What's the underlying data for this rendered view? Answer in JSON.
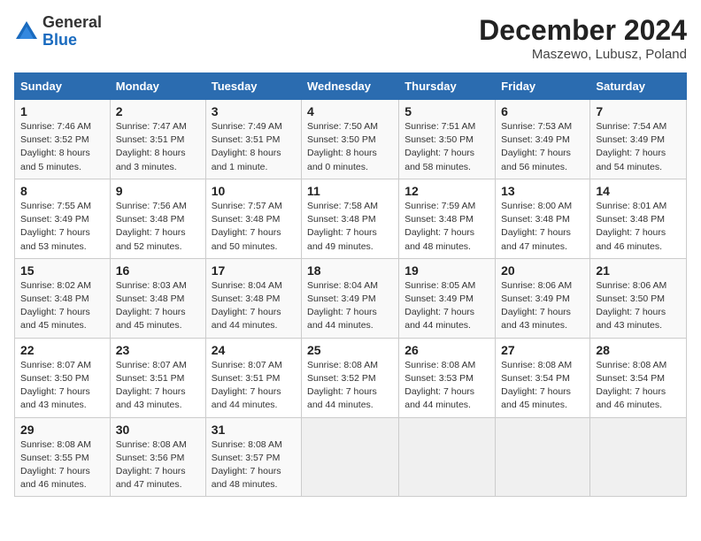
{
  "logo": {
    "general": "General",
    "blue": "Blue"
  },
  "title": "December 2024",
  "location": "Maszewo, Lubusz, Poland",
  "days_of_week": [
    "Sunday",
    "Monday",
    "Tuesday",
    "Wednesday",
    "Thursday",
    "Friday",
    "Saturday"
  ],
  "weeks": [
    [
      {
        "day": "1",
        "info": "Sunrise: 7:46 AM\nSunset: 3:52 PM\nDaylight: 8 hours\nand 5 minutes."
      },
      {
        "day": "2",
        "info": "Sunrise: 7:47 AM\nSunset: 3:51 PM\nDaylight: 8 hours\nand 3 minutes."
      },
      {
        "day": "3",
        "info": "Sunrise: 7:49 AM\nSunset: 3:51 PM\nDaylight: 8 hours\nand 1 minute."
      },
      {
        "day": "4",
        "info": "Sunrise: 7:50 AM\nSunset: 3:50 PM\nDaylight: 8 hours\nand 0 minutes."
      },
      {
        "day": "5",
        "info": "Sunrise: 7:51 AM\nSunset: 3:50 PM\nDaylight: 7 hours\nand 58 minutes."
      },
      {
        "day": "6",
        "info": "Sunrise: 7:53 AM\nSunset: 3:49 PM\nDaylight: 7 hours\nand 56 minutes."
      },
      {
        "day": "7",
        "info": "Sunrise: 7:54 AM\nSunset: 3:49 PM\nDaylight: 7 hours\nand 54 minutes."
      }
    ],
    [
      {
        "day": "8",
        "info": "Sunrise: 7:55 AM\nSunset: 3:49 PM\nDaylight: 7 hours\nand 53 minutes."
      },
      {
        "day": "9",
        "info": "Sunrise: 7:56 AM\nSunset: 3:48 PM\nDaylight: 7 hours\nand 52 minutes."
      },
      {
        "day": "10",
        "info": "Sunrise: 7:57 AM\nSunset: 3:48 PM\nDaylight: 7 hours\nand 50 minutes."
      },
      {
        "day": "11",
        "info": "Sunrise: 7:58 AM\nSunset: 3:48 PM\nDaylight: 7 hours\nand 49 minutes."
      },
      {
        "day": "12",
        "info": "Sunrise: 7:59 AM\nSunset: 3:48 PM\nDaylight: 7 hours\nand 48 minutes."
      },
      {
        "day": "13",
        "info": "Sunrise: 8:00 AM\nSunset: 3:48 PM\nDaylight: 7 hours\nand 47 minutes."
      },
      {
        "day": "14",
        "info": "Sunrise: 8:01 AM\nSunset: 3:48 PM\nDaylight: 7 hours\nand 46 minutes."
      }
    ],
    [
      {
        "day": "15",
        "info": "Sunrise: 8:02 AM\nSunset: 3:48 PM\nDaylight: 7 hours\nand 45 minutes."
      },
      {
        "day": "16",
        "info": "Sunrise: 8:03 AM\nSunset: 3:48 PM\nDaylight: 7 hours\nand 45 minutes."
      },
      {
        "day": "17",
        "info": "Sunrise: 8:04 AM\nSunset: 3:48 PM\nDaylight: 7 hours\nand 44 minutes."
      },
      {
        "day": "18",
        "info": "Sunrise: 8:04 AM\nSunset: 3:49 PM\nDaylight: 7 hours\nand 44 minutes."
      },
      {
        "day": "19",
        "info": "Sunrise: 8:05 AM\nSunset: 3:49 PM\nDaylight: 7 hours\nand 44 minutes."
      },
      {
        "day": "20",
        "info": "Sunrise: 8:06 AM\nSunset: 3:49 PM\nDaylight: 7 hours\nand 43 minutes."
      },
      {
        "day": "21",
        "info": "Sunrise: 8:06 AM\nSunset: 3:50 PM\nDaylight: 7 hours\nand 43 minutes."
      }
    ],
    [
      {
        "day": "22",
        "info": "Sunrise: 8:07 AM\nSunset: 3:50 PM\nDaylight: 7 hours\nand 43 minutes."
      },
      {
        "day": "23",
        "info": "Sunrise: 8:07 AM\nSunset: 3:51 PM\nDaylight: 7 hours\nand 43 minutes."
      },
      {
        "day": "24",
        "info": "Sunrise: 8:07 AM\nSunset: 3:51 PM\nDaylight: 7 hours\nand 44 minutes."
      },
      {
        "day": "25",
        "info": "Sunrise: 8:08 AM\nSunset: 3:52 PM\nDaylight: 7 hours\nand 44 minutes."
      },
      {
        "day": "26",
        "info": "Sunrise: 8:08 AM\nSunset: 3:53 PM\nDaylight: 7 hours\nand 44 minutes."
      },
      {
        "day": "27",
        "info": "Sunrise: 8:08 AM\nSunset: 3:54 PM\nDaylight: 7 hours\nand 45 minutes."
      },
      {
        "day": "28",
        "info": "Sunrise: 8:08 AM\nSunset: 3:54 PM\nDaylight: 7 hours\nand 46 minutes."
      }
    ],
    [
      {
        "day": "29",
        "info": "Sunrise: 8:08 AM\nSunset: 3:55 PM\nDaylight: 7 hours\nand 46 minutes."
      },
      {
        "day": "30",
        "info": "Sunrise: 8:08 AM\nSunset: 3:56 PM\nDaylight: 7 hours\nand 47 minutes."
      },
      {
        "day": "31",
        "info": "Sunrise: 8:08 AM\nSunset: 3:57 PM\nDaylight: 7 hours\nand 48 minutes."
      },
      {
        "day": "",
        "info": ""
      },
      {
        "day": "",
        "info": ""
      },
      {
        "day": "",
        "info": ""
      },
      {
        "day": "",
        "info": ""
      }
    ]
  ]
}
